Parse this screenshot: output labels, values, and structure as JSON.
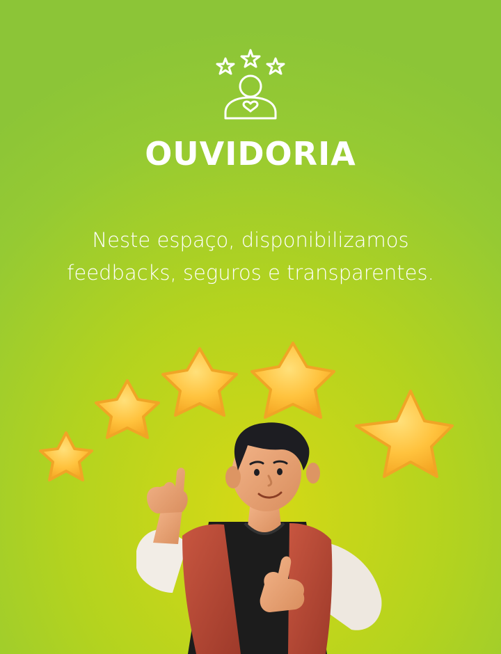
{
  "header": {
    "icon": "rating-person-icon",
    "title": "OUVIDORIA"
  },
  "main": {
    "description": "Neste espaço, disponibilizamos feedbacks, seguros e transparentes."
  },
  "illustration": {
    "stars_icon": "star-icon",
    "person_icon": "person-thumbs-up-illustration",
    "colors": {
      "background_top": "#8cc537",
      "background_center": "#d6d915",
      "star": "#ffc23d",
      "vest": "#b84a36",
      "shirt": "#1c1c1c",
      "sleeve": "#f2ede6",
      "skin": "#e8a273",
      "hair": "#1d1d22"
    }
  }
}
